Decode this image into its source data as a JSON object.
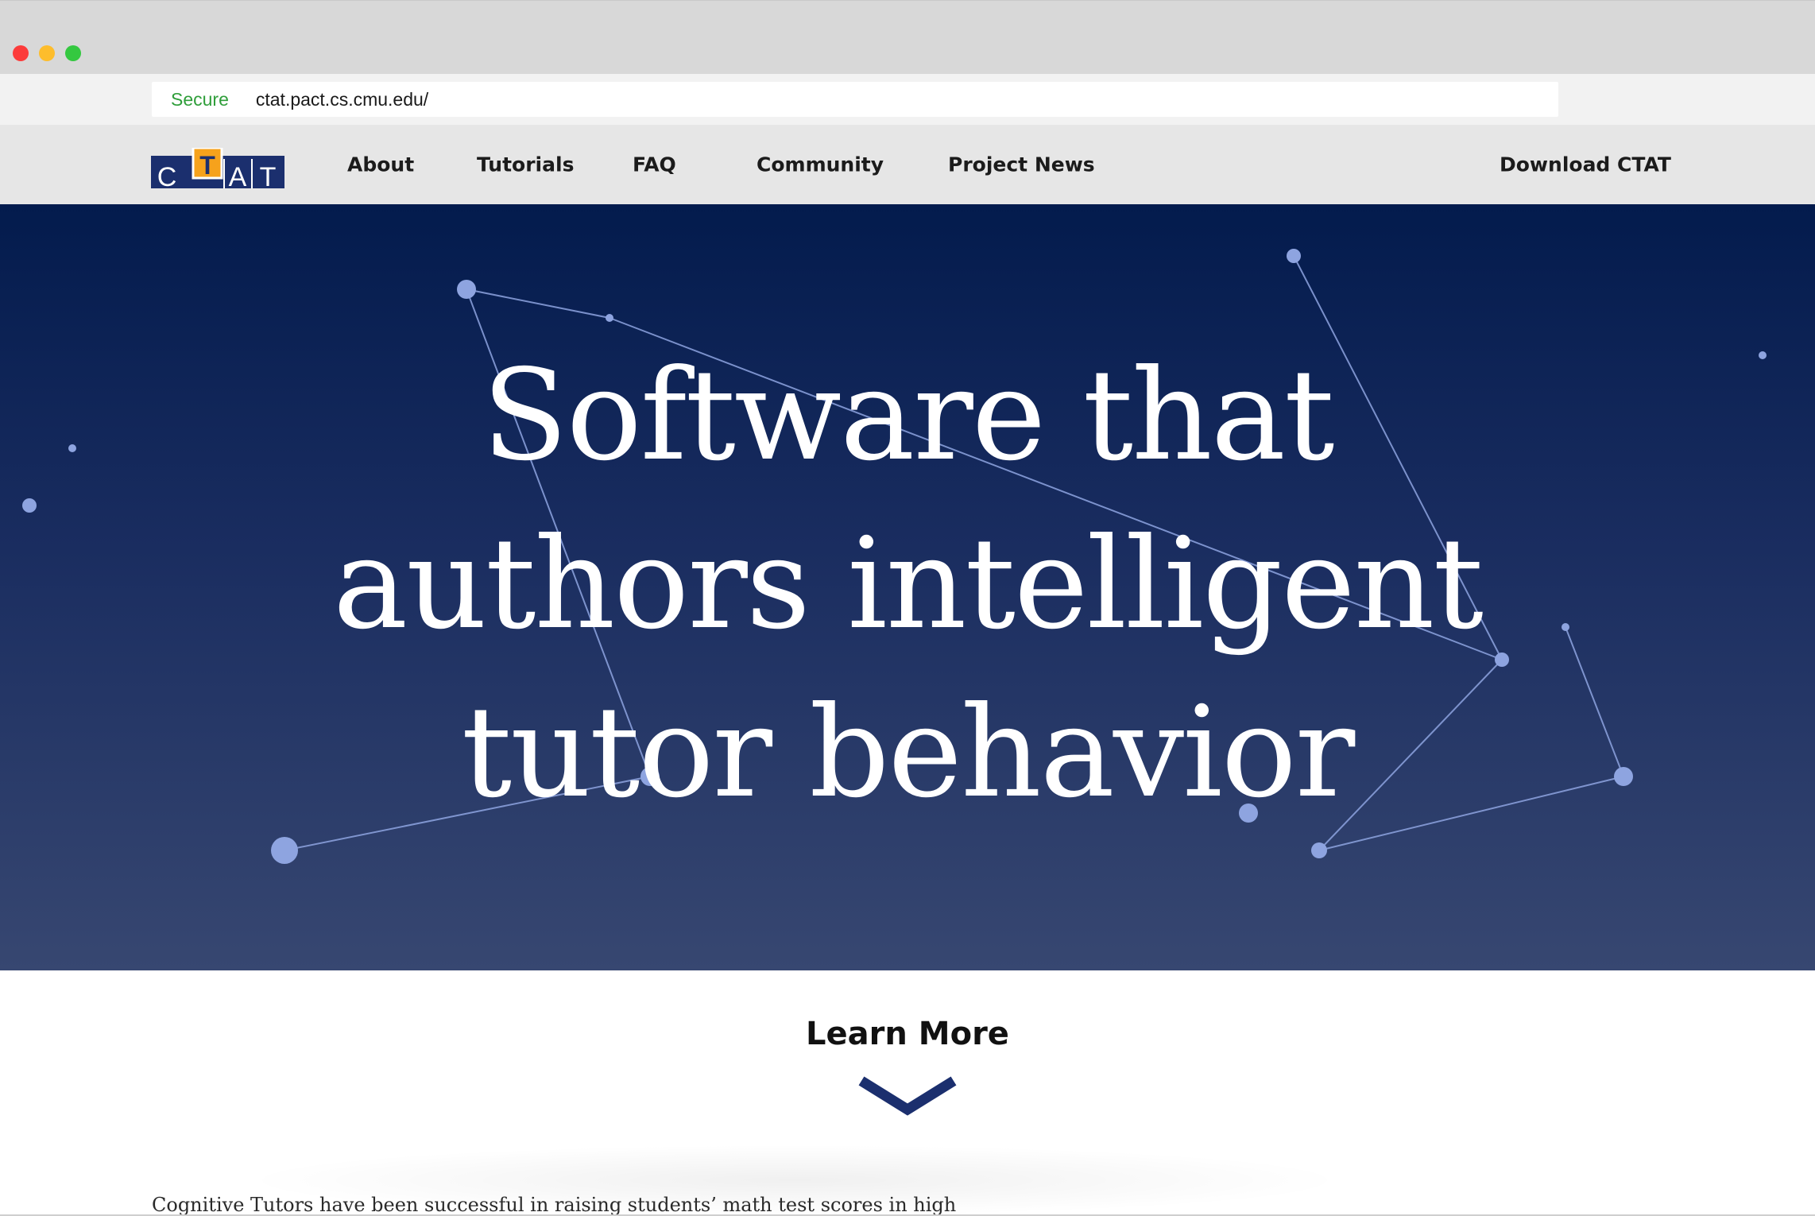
{
  "browser": {
    "secure_label": "Secure",
    "url": "ctat.pact.cs.cmu.edu/"
  },
  "nav": {
    "logo_letters": [
      "C",
      "T",
      "A",
      "T"
    ],
    "items": [
      {
        "label": "About"
      },
      {
        "label": "Tutorials"
      },
      {
        "label": "FAQ"
      },
      {
        "label": "Community"
      },
      {
        "label": "Project News"
      }
    ],
    "download_label": "Download CTAT"
  },
  "hero": {
    "title_lines": [
      "Software that",
      "authors intelligent",
      "tutor behavior"
    ]
  },
  "learn_more": {
    "label": "Learn More",
    "icon": "chevron-down-icon"
  },
  "intro": {
    "text": "Cognitive Tutors have been successful in raising students’ math test scores in high"
  },
  "colors": {
    "hero_top": "#031b4d",
    "hero_bottom": "#374771",
    "logo_blue": "#1b2f6e",
    "logo_orange": "#f6a21c",
    "constellation": "#8ea4e0",
    "chevron": "#1b2f6e",
    "secure_green": "#2f9e3a"
  }
}
